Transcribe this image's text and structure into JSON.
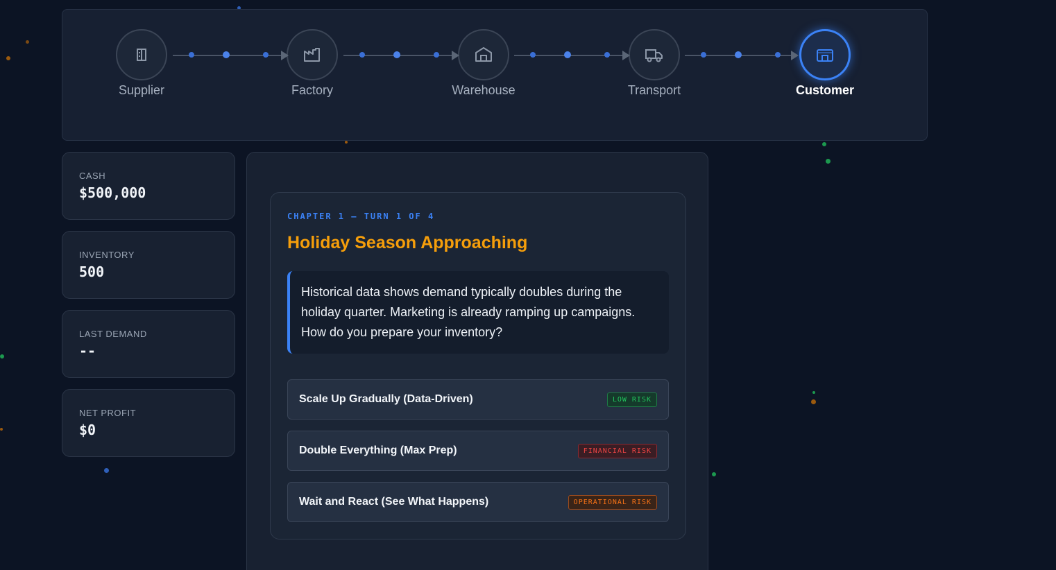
{
  "pipeline": {
    "nodes": [
      {
        "label": "Supplier",
        "icon": "building-icon",
        "active": false
      },
      {
        "label": "Factory",
        "icon": "factory-icon",
        "active": false
      },
      {
        "label": "Warehouse",
        "icon": "warehouse-icon",
        "active": false
      },
      {
        "label": "Transport",
        "icon": "truck-icon",
        "active": false
      },
      {
        "label": "Customer",
        "icon": "storefront-icon",
        "active": true
      }
    ],
    "accent_color": "#3b82f6"
  },
  "stats": [
    {
      "label": "CASH",
      "value": "$500,000"
    },
    {
      "label": "INVENTORY",
      "value": "500"
    },
    {
      "label": "LAST DEMAND",
      "value": "--"
    },
    {
      "label": "NET PROFIT",
      "value": "$0"
    }
  ],
  "scenario": {
    "chapter": "CHAPTER 1 — TURN 1 OF 4",
    "title": "Holiday Season Approaching",
    "description": "Historical data shows demand typically doubles during the holiday quarter. Marketing is already ramping up campaigns. How do you prepare your inventory?",
    "title_color": "#f59e0b",
    "options": [
      {
        "label": "Scale Up Gradually (Data-Driven)",
        "risk": "LOW RISK",
        "risk_color": "#22c55e"
      },
      {
        "label": "Double Everything (Max Prep)",
        "risk": "FINANCIAL RISK",
        "risk_color": "#ef4444"
      },
      {
        "label": "Wait and React (See What Happens)",
        "risk": "OPERATIONAL RISK",
        "risk_color": "#f97316"
      }
    ]
  }
}
